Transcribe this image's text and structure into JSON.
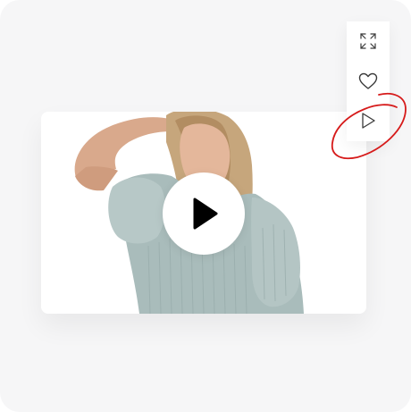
{
  "colors": {
    "background": "#f6f6f7",
    "card": "#ffffff",
    "icon": "#3a3a3a",
    "annotation": "#d61a1a",
    "play_glyph": "#000000"
  },
  "toolbar": {
    "expand_icon": "expand-icon",
    "favorite_icon": "heart-icon",
    "play_icon": "play-icon"
  },
  "video": {
    "thumbnail": "woman-in-sage-blouse",
    "play_icon": "play-icon"
  }
}
